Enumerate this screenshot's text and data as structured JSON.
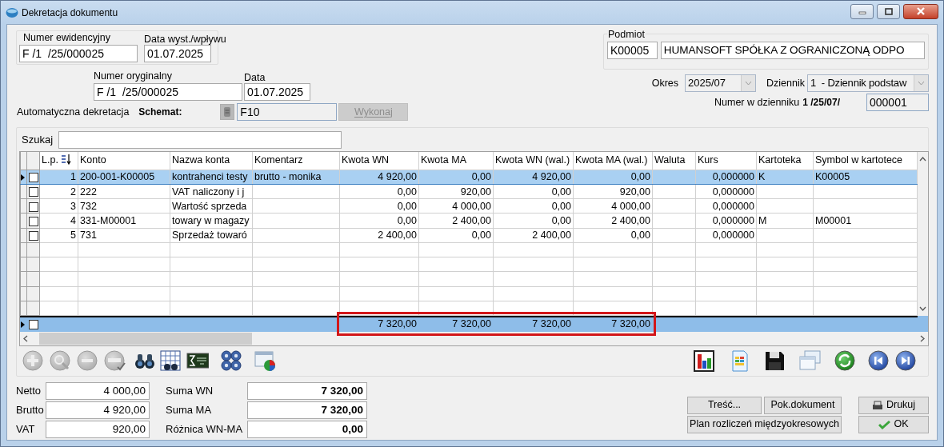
{
  "window": {
    "title": "Dekretacja dokumentu"
  },
  "header": {
    "numer_ewidencyjny": {
      "label": "Numer ewidencyjny",
      "value": "F /1  /25/000025"
    },
    "data_wyst": {
      "label": "Data wyst./wpływu",
      "value": "01.07.2025"
    },
    "numer_oryginalny": {
      "label": "Numer oryginalny",
      "value": "F /1  /25/000025"
    },
    "data": {
      "label": "Data",
      "value": "01.07.2025"
    },
    "automatyczna_dekretacja": {
      "label": "Automatyczna dekretacja"
    },
    "schemat": {
      "label": "Schemat:",
      "value": "F10"
    },
    "wykonaj": {
      "label": "Wykonaj",
      "disabled": true
    },
    "podmiot": {
      "label": "Podmiot",
      "code": "K00005",
      "name": "HUMANSOFT SPÓŁKA Z OGRANICZONĄ ODPO"
    },
    "okres": {
      "label": "Okres",
      "value": "2025/07"
    },
    "dziennik": {
      "label": "Dziennik",
      "value": "1  - Dziennik podstaw"
    },
    "numer_w_dzienniku": {
      "label": "Numer w dzienniku",
      "prefix": "1 /25/07/",
      "value": "000001"
    }
  },
  "search": {
    "label": "Szukaj"
  },
  "table": {
    "columns": [
      {
        "label": "L.p.",
        "kind": "number",
        "sorted": true
      },
      {
        "label": "Konto",
        "kind": "text",
        "sorted": false
      },
      {
        "label": "Nazwa konta",
        "kind": "text",
        "sorted": false
      },
      {
        "label": "Komentarz",
        "kind": "text",
        "sorted": false
      },
      {
        "label": "Kwota WN",
        "kind": "number",
        "sorted": false
      },
      {
        "label": "Kwota MA",
        "kind": "number",
        "sorted": false
      },
      {
        "label": "Kwota WN (wal.)",
        "kind": "number",
        "sorted": false
      },
      {
        "label": "Kwota MA (wal.)",
        "kind": "number",
        "sorted": false
      },
      {
        "label": "Waluta",
        "kind": "text",
        "sorted": false
      },
      {
        "label": "Kurs",
        "kind": "number",
        "sorted": false
      },
      {
        "label": "Kartoteka",
        "kind": "text",
        "sorted": false
      },
      {
        "label": "Symbol w kartotece",
        "kind": "text",
        "sorted": false
      }
    ],
    "rows": [
      {
        "selected": true,
        "checked": false,
        "cells": [
          "1",
          "200-001-K00005",
          "kontrahenci testy",
          "brutto - monika",
          "4 920,00",
          "0,00",
          "4 920,00",
          "0,00",
          "",
          "0,000000",
          "K",
          "K00005"
        ]
      },
      {
        "selected": false,
        "checked": false,
        "cells": [
          "2",
          "222",
          "VAT naliczony i j",
          "",
          "0,00",
          "920,00",
          "0,00",
          "920,00",
          "",
          "0,000000",
          "",
          ""
        ]
      },
      {
        "selected": false,
        "checked": false,
        "cells": [
          "3",
          "732",
          "Wartość sprzeda",
          "",
          "0,00",
          "4 000,00",
          "0,00",
          "4 000,00",
          "",
          "0,000000",
          "",
          ""
        ]
      },
      {
        "selected": false,
        "checked": false,
        "cells": [
          "4",
          "331-M00001",
          "towary w magazy",
          "",
          "0,00",
          "2 400,00",
          "0,00",
          "2 400,00",
          "",
          "0,000000",
          "M",
          "M00001"
        ]
      },
      {
        "selected": false,
        "checked": false,
        "cells": [
          "5",
          "731",
          "Sprzedaż towaró",
          "",
          "2 400,00",
          "0,00",
          "2 400,00",
          "0,00",
          "",
          "0,000000",
          "",
          ""
        ]
      }
    ],
    "footer": {
      "checked": false,
      "highlighted": true,
      "cells": [
        "",
        "",
        "",
        "",
        "7 320,00",
        "7 320,00",
        "7 320,00",
        "7 320,00",
        "",
        "",
        "",
        ""
      ]
    }
  },
  "toolbar": {
    "left": [
      {
        "kind": "add",
        "disabled": true
      },
      {
        "kind": "preview",
        "disabled": true
      },
      {
        "kind": "remove",
        "disabled": true
      },
      {
        "kind": "approve",
        "disabled": true
      },
      {
        "kind": "find",
        "disabled": false
      },
      {
        "kind": "filter",
        "disabled": false
      },
      {
        "kind": "formula",
        "disabled": false
      },
      {
        "kind": "settings",
        "disabled": false
      },
      {
        "kind": "window-chart",
        "disabled": false
      }
    ],
    "right": [
      {
        "kind": "chart",
        "disabled": false
      },
      {
        "kind": "document",
        "disabled": false
      },
      {
        "kind": "save",
        "disabled": false
      },
      {
        "kind": "windows",
        "disabled": false
      },
      {
        "kind": "refresh",
        "disabled": false
      },
      {
        "kind": "first",
        "disabled": false
      },
      {
        "kind": "last",
        "disabled": false
      }
    ]
  },
  "summary": {
    "left": [
      {
        "label": "Netto",
        "value": "4 000,00"
      },
      {
        "label": "Brutto",
        "value": "4 920,00"
      },
      {
        "label": "VAT",
        "value": "920,00"
      }
    ],
    "right": [
      {
        "label": "Suma WN",
        "value": "7 320,00"
      },
      {
        "label": "Suma MA",
        "value": "7 320,00"
      },
      {
        "label": "Różnica WN-MA",
        "value": "0,00"
      }
    ]
  },
  "buttons": [
    {
      "label": "Treść...",
      "kind": "plain"
    },
    {
      "label": "Pok.dokument",
      "kind": "plain"
    },
    {
      "label": "Drukuj",
      "kind": "print"
    },
    {
      "label": "Plan rozliczeń międzyokresowych",
      "kind": "wide"
    },
    {
      "label": "OK",
      "kind": "ok"
    }
  ]
}
